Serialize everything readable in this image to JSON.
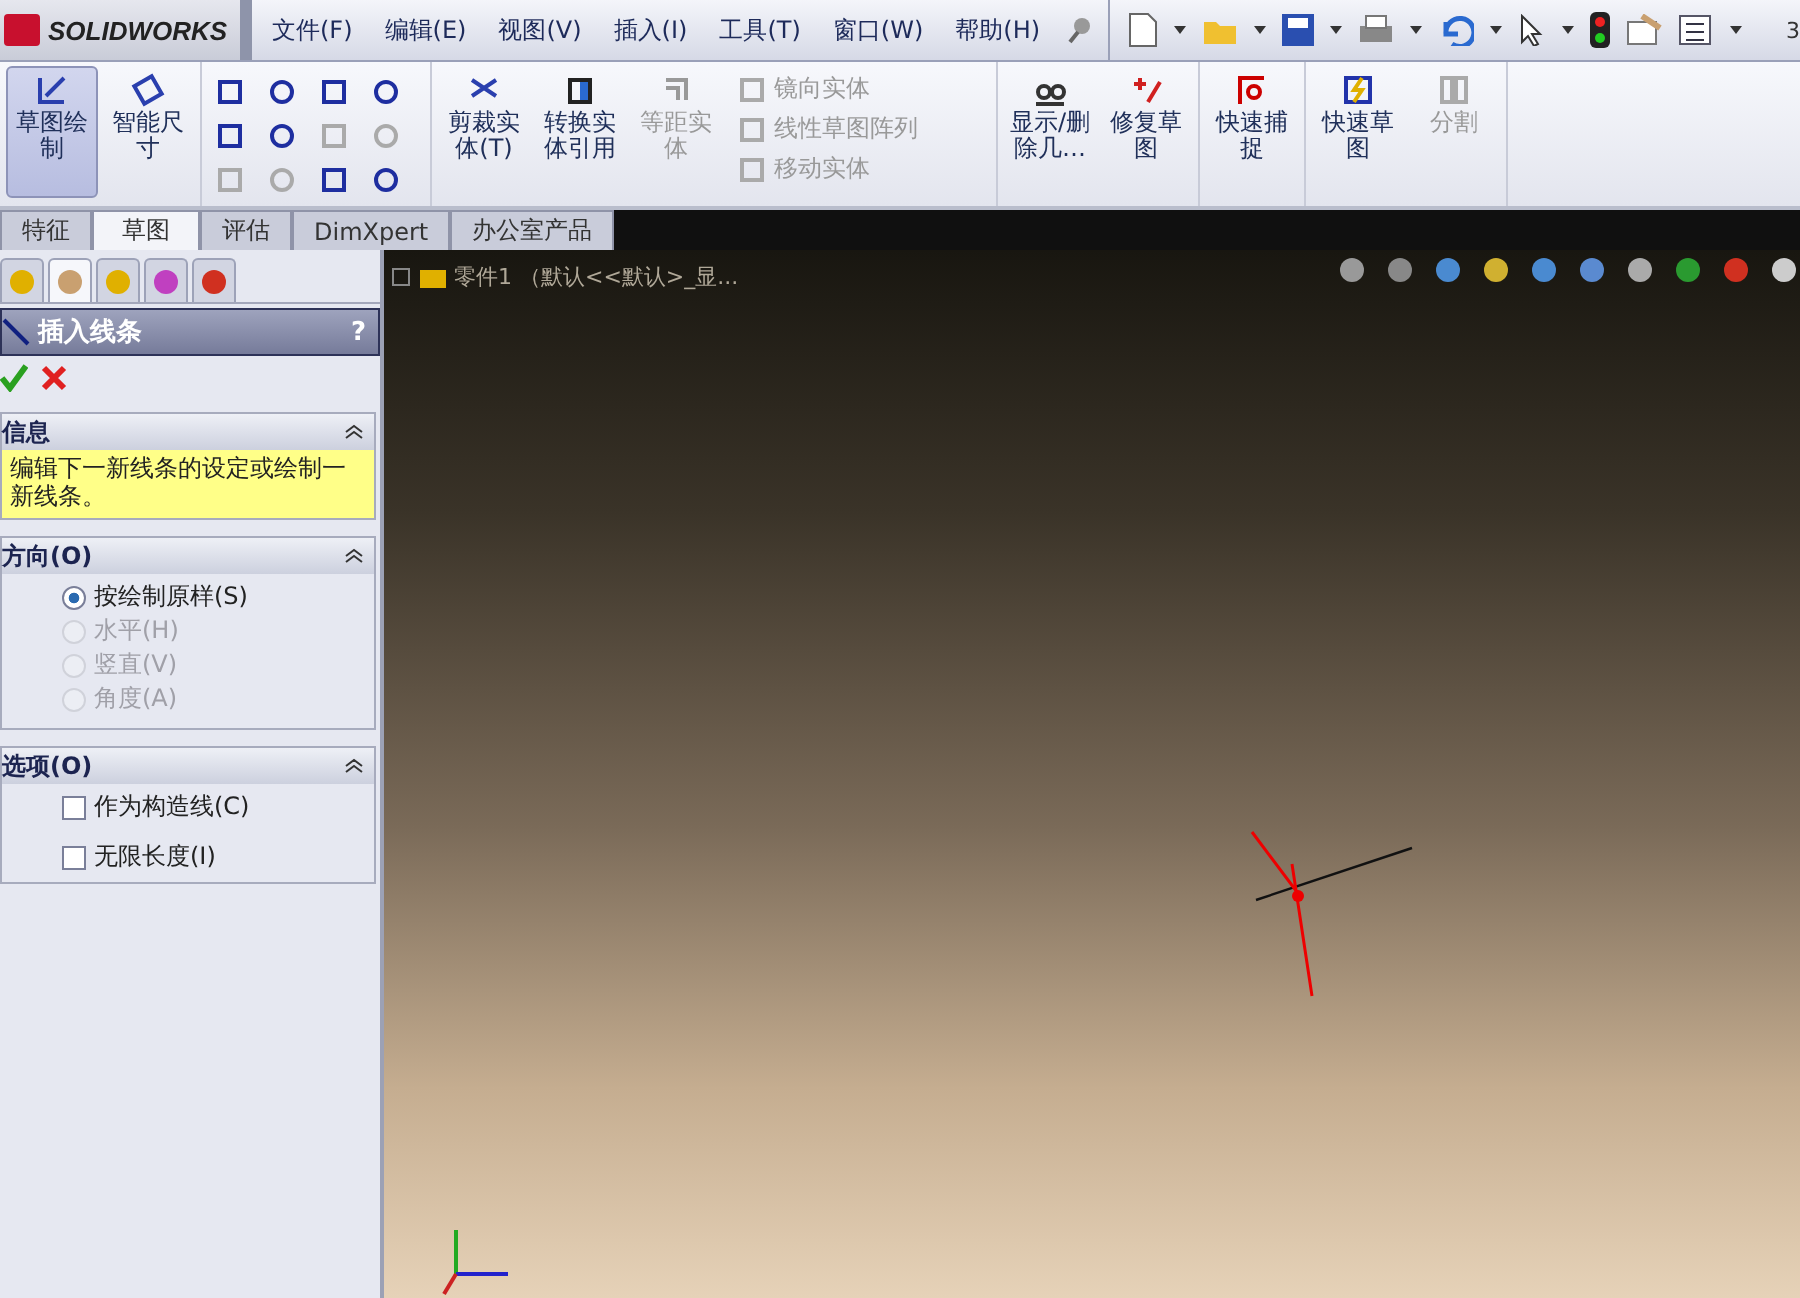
{
  "app": {
    "logo": "SOLIDWORKS"
  },
  "menu": [
    {
      "label": "文件(F)"
    },
    {
      "label": "编辑(E)"
    },
    {
      "label": "视图(V)"
    },
    {
      "label": "插入(I)"
    },
    {
      "label": "工具(T)"
    },
    {
      "label": "窗口(W)"
    },
    {
      "label": "帮助(H)"
    }
  ],
  "quick_toolbar": {
    "cut_text": "3"
  },
  "ribbon": {
    "sketch_buttons": [
      {
        "label": "草图绘制",
        "selected": true,
        "disabled": false
      },
      {
        "label": "智能尺寸",
        "selected": false,
        "disabled": false
      }
    ],
    "big_buttons": [
      {
        "label": "剪裁实体(T)",
        "disabled": false
      },
      {
        "label": "转换实体引用",
        "disabled": false
      },
      {
        "label": "等距实体",
        "disabled": true
      }
    ],
    "list_commands": [
      {
        "label": "镜向实体",
        "disabled": true
      },
      {
        "label": "线性草图阵列",
        "disabled": true
      },
      {
        "label": "移动实体",
        "disabled": true
      }
    ],
    "right_buttons": [
      {
        "label": "显示/删除几…",
        "disabled": false
      },
      {
        "label": "修复草图",
        "disabled": false
      },
      {
        "label": "快速捕捉",
        "disabled": false
      },
      {
        "label": "快速草图",
        "disabled": false
      },
      {
        "label": "分割",
        "disabled": true
      }
    ]
  },
  "tabs": [
    {
      "label": "特征",
      "selected": false
    },
    {
      "label": "草图",
      "selected": true
    },
    {
      "label": "评估",
      "selected": false
    },
    {
      "label": "DimXpert",
      "selected": false
    },
    {
      "label": "办公室产品",
      "selected": false
    }
  ],
  "panel_tabs": [
    {
      "selected": false
    },
    {
      "selected": true
    },
    {
      "selected": false
    },
    {
      "selected": false
    },
    {
      "selected": false
    }
  ],
  "property_manager": {
    "title": "插入线条",
    "help": "?",
    "info": {
      "title": "信息",
      "message": "编辑下一新线条的设定或绘制一新线条。"
    },
    "orientation": {
      "title": "方向(O)",
      "options": [
        {
          "label": "按绘制原样(S)",
          "selected": true,
          "disabled": false
        },
        {
          "label": "水平(H)",
          "selected": false,
          "disabled": true
        },
        {
          "label": "竖直(V)",
          "selected": false,
          "disabled": true
        },
        {
          "label": "角度(A)",
          "selected": false,
          "disabled": true
        }
      ]
    },
    "options": {
      "title": "选项(O)",
      "items": [
        {
          "label": "作为构造线(C)",
          "checked": false
        },
        {
          "label": "无限长度(I)",
          "checked": false
        }
      ]
    }
  },
  "tree": {
    "label": "零件1 （默认<<默认>_显..."
  }
}
